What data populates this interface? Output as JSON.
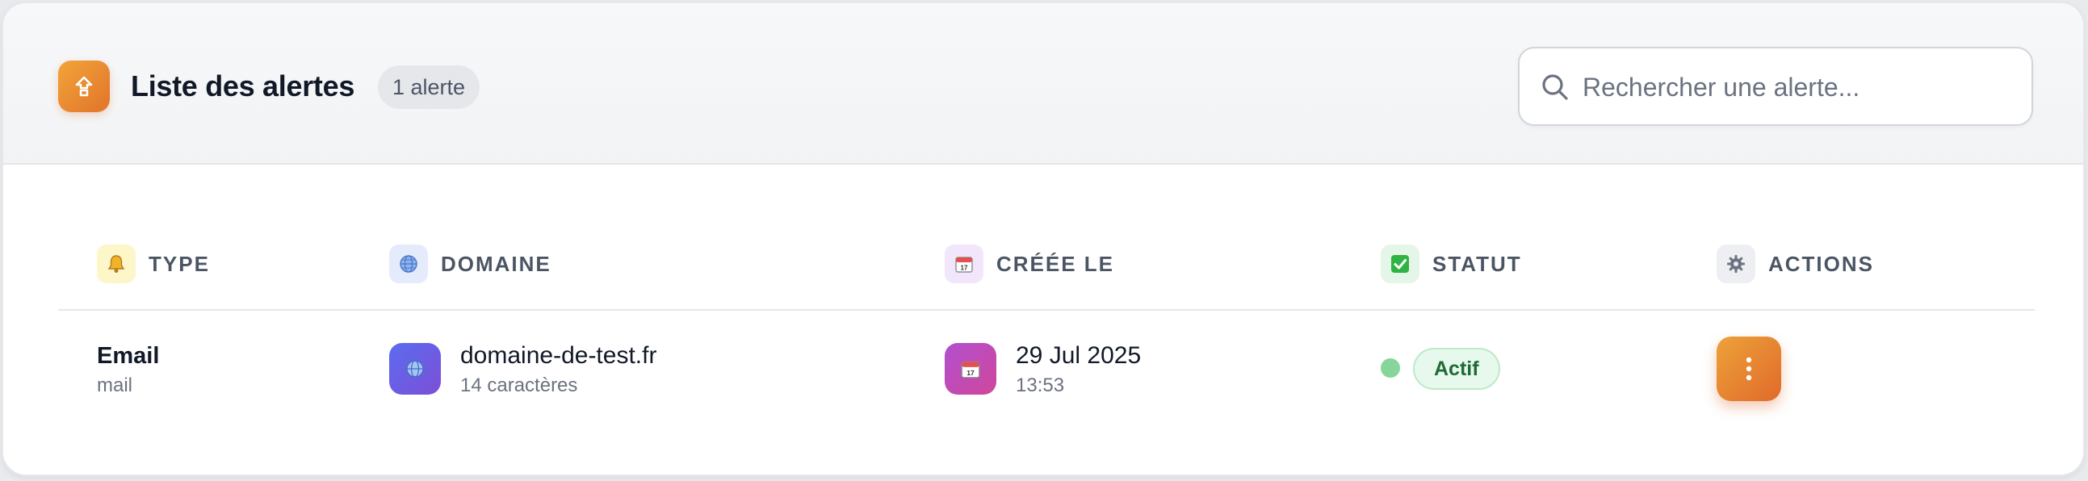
{
  "header": {
    "title": "Liste des alertes",
    "count_badge": "1 alerte",
    "logo_icon": "alert-arrow-icon",
    "search": {
      "placeholder": "Rechercher une alerte...",
      "value": "",
      "icon": "search-icon"
    }
  },
  "table": {
    "columns": [
      {
        "label": "TYPE",
        "icon": "bell-icon",
        "icon_bg": "#fdf6c8"
      },
      {
        "label": "DOMAINE",
        "icon": "globe-icon",
        "icon_bg": "#e4ebfb"
      },
      {
        "label": "CRÉÉE LE",
        "icon": "calendar-icon",
        "icon_bg": "#f1e6fa"
      },
      {
        "label": "STATUT",
        "icon": "check-icon",
        "icon_bg": "#e3f6e7"
      },
      {
        "label": "ACTIONS",
        "icon": "gear-icon",
        "icon_bg": "#eeeff2"
      }
    ],
    "rows": [
      {
        "type": "Email",
        "type_sub": "mail",
        "domain": "domaine-de-test.fr",
        "domain_sub": "14 caractères",
        "created_date": "29 Jul 2025",
        "created_time": "13:53",
        "status": "Actif",
        "actions_icon": "more-vertical-icon"
      }
    ]
  },
  "colors": {
    "accent_orange": "#e1742a",
    "domain_icon_gradient": [
      "#5b6cf0",
      "#7c4fd6"
    ],
    "calendar_icon_gradient": [
      "#b24fd0",
      "#d0479a"
    ],
    "status_green": "#86d69c"
  }
}
